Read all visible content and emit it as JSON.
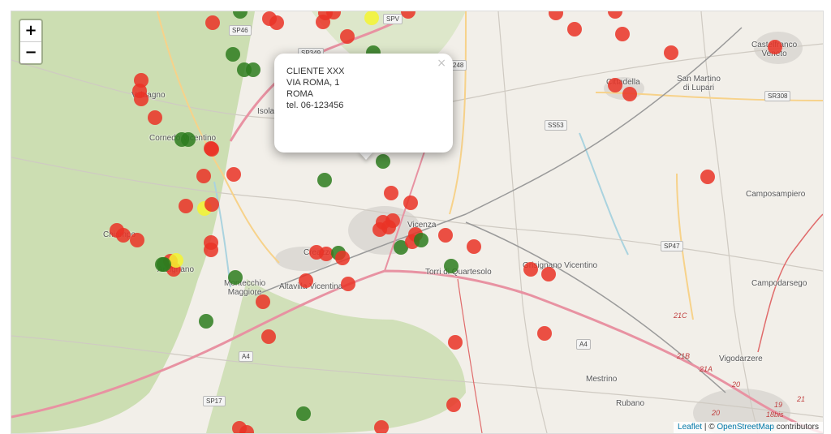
{
  "zoom": {
    "in_label": "+",
    "out_label": "−"
  },
  "popup": {
    "close_label": "×",
    "lines": [
      "CLIENTE XXX",
      "VIA ROMA, 1",
      "ROMA",
      "tel. 06-123456"
    ]
  },
  "attribution": {
    "leaflet": "Leaflet",
    "separator": " | © ",
    "osm": "OpenStreetMap",
    "suffix": " contributors"
  },
  "colors": {
    "red": "#ea3326",
    "green": "#2e7d1f",
    "yellow": "#f5f531",
    "land": "#f2efe9",
    "hills": "#b9d39a",
    "motorway": "#e892a2"
  },
  "places": [
    {
      "name": "Castelfranco",
      "line2": "Veneto"
    },
    {
      "name": "San Martino",
      "line2": "di Lupari"
    },
    {
      "name": "Cittadella"
    },
    {
      "name": "Isola"
    },
    {
      "name": "Cornedo Vicentino"
    },
    {
      "name": "Vicenza"
    },
    {
      "name": "Camposampiero"
    },
    {
      "name": "Torri di Quartesolo"
    },
    {
      "name": "Grisignano Vicentino"
    },
    {
      "name": "Montecchio",
      "line2": "Maggiore"
    },
    {
      "name": "Altavilla Vicentina"
    },
    {
      "name": "Creazzo"
    },
    {
      "name": "Campodarsego"
    },
    {
      "name": "Vigodarzere"
    },
    {
      "name": "Mestrino"
    },
    {
      "name": "Rubano"
    },
    {
      "name": "Valdagno"
    },
    {
      "name": "Chiampo"
    },
    {
      "name": "Arzignano"
    }
  ],
  "roads": [
    "SP46",
    "SPV",
    "SP349",
    "248",
    "SR308",
    "SS53",
    "SP47",
    "A4",
    "A4",
    "SP17",
    "21C",
    "21B",
    "21A",
    "20",
    "20",
    "19",
    "18bis",
    "21"
  ],
  "markers": [
    {
      "c": "green",
      "lat": 45.72
    },
    {
      "c": "red"
    },
    {
      "c": "red"
    },
    {
      "c": "red"
    },
    {
      "c": "yellow"
    },
    {
      "c": "red"
    },
    {
      "c": "red"
    },
    {
      "c": "red"
    },
    {
      "c": "red"
    },
    {
      "c": "red"
    },
    {
      "c": "red"
    },
    {
      "c": "red"
    },
    {
      "c": "red"
    },
    {
      "c": "green"
    },
    {
      "c": "green"
    },
    {
      "c": "green"
    },
    {
      "c": "green"
    },
    {
      "c": "red"
    },
    {
      "c": "red"
    },
    {
      "c": "red"
    },
    {
      "c": "red"
    },
    {
      "c": "red"
    },
    {
      "c": "green"
    },
    {
      "c": "green"
    },
    {
      "c": "red"
    },
    {
      "c": "red"
    },
    {
      "c": "red"
    },
    {
      "c": "green"
    },
    {
      "c": "red"
    },
    {
      "c": "red"
    },
    {
      "c": "red"
    },
    {
      "c": "yellow"
    },
    {
      "c": "red"
    },
    {
      "c": "red"
    },
    {
      "c": "red"
    },
    {
      "c": "red"
    },
    {
      "c": "red"
    },
    {
      "c": "red"
    },
    {
      "c": "red"
    },
    {
      "c": "red"
    },
    {
      "c": "red"
    },
    {
      "c": "red"
    },
    {
      "c": "green"
    },
    {
      "c": "green"
    },
    {
      "c": "red"
    },
    {
      "c": "red"
    },
    {
      "c": "red"
    },
    {
      "c": "red"
    },
    {
      "c": "red"
    },
    {
      "c": "red"
    },
    {
      "c": "red"
    },
    {
      "c": "red"
    },
    {
      "c": "red"
    },
    {
      "c": "red"
    },
    {
      "c": "green"
    },
    {
      "c": "red"
    },
    {
      "c": "yellow"
    },
    {
      "c": "red"
    },
    {
      "c": "green"
    },
    {
      "c": "red"
    },
    {
      "c": "red"
    },
    {
      "c": "red"
    },
    {
      "c": "red"
    },
    {
      "c": "red"
    },
    {
      "c": "red"
    },
    {
      "c": "red"
    },
    {
      "c": "green"
    },
    {
      "c": "red"
    },
    {
      "c": "green"
    },
    {
      "c": "red"
    },
    {
      "c": "green"
    },
    {
      "c": "red"
    },
    {
      "c": "red"
    },
    {
      "c": "red"
    },
    {
      "c": "red"
    },
    {
      "c": "red"
    },
    {
      "c": "green"
    },
    {
      "c": "green"
    },
    {
      "c": "green"
    },
    {
      "c": "red"
    }
  ]
}
